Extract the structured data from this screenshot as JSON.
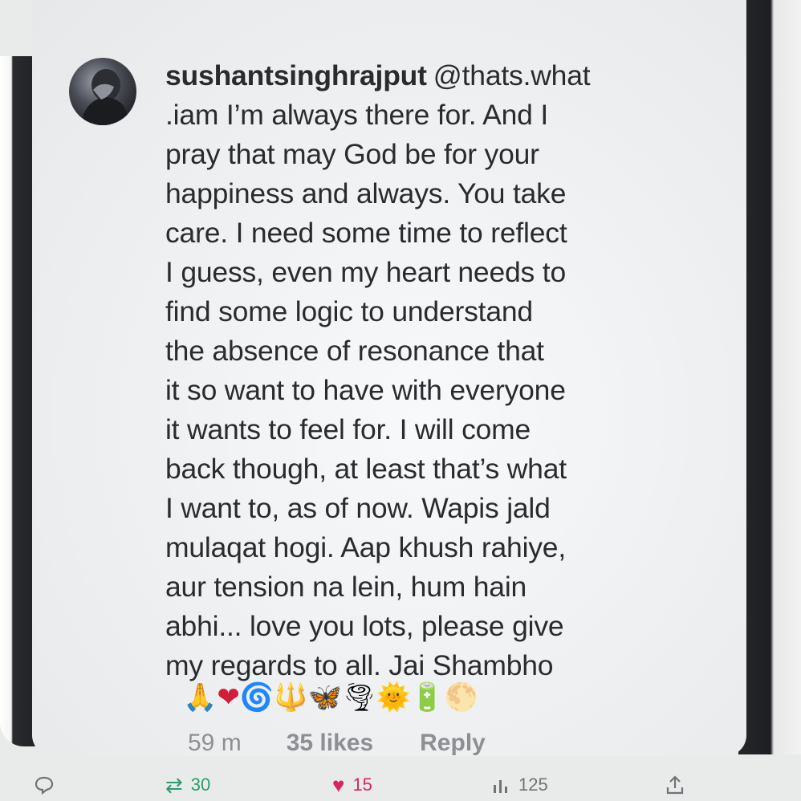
{
  "comment": {
    "username": "sushantsinghrajput",
    "lines": [
      "@thats.what",
      ".iam I’m always there for. And I",
      "pray that may God be for your",
      "happiness and always. You take",
      "care. I need some time to reflect",
      "I guess, even my heart needs to",
      "find some logic to understand",
      "the absence of resonance that",
      "it so want to have with everyone",
      "it wants to feel for. I will come",
      "back though, at least that’s what",
      "I want to, as of now. Wapis jald",
      "mulaqat hogi. Aap khush rahiye,",
      "aur tension na lein, hum hain",
      "abhi... love you lots, please give",
      "my regards to all. Jai Shambho"
    ],
    "emojis": [
      "🙏",
      "❤",
      "🌀",
      "🔱",
      "🦋",
      "🌪",
      "🌞",
      "🔋",
      "🌕"
    ],
    "time": "59 m",
    "likes": "35 likes",
    "reply_label": "Reply"
  },
  "tweet_actions": {
    "retweets": "30",
    "likes": "15",
    "views": "125"
  },
  "icons": {
    "reply": "comment-bubble-icon",
    "retweet": "retweet-icon",
    "like": "heart-icon",
    "views": "bar-chart-icon",
    "share": "share-icon"
  },
  "colors": {
    "text": "#2a2b2e",
    "meta": "#8d8f93",
    "retweet": "#2a9d6a",
    "like": "#d9245e",
    "accent": "#3a86d6"
  }
}
